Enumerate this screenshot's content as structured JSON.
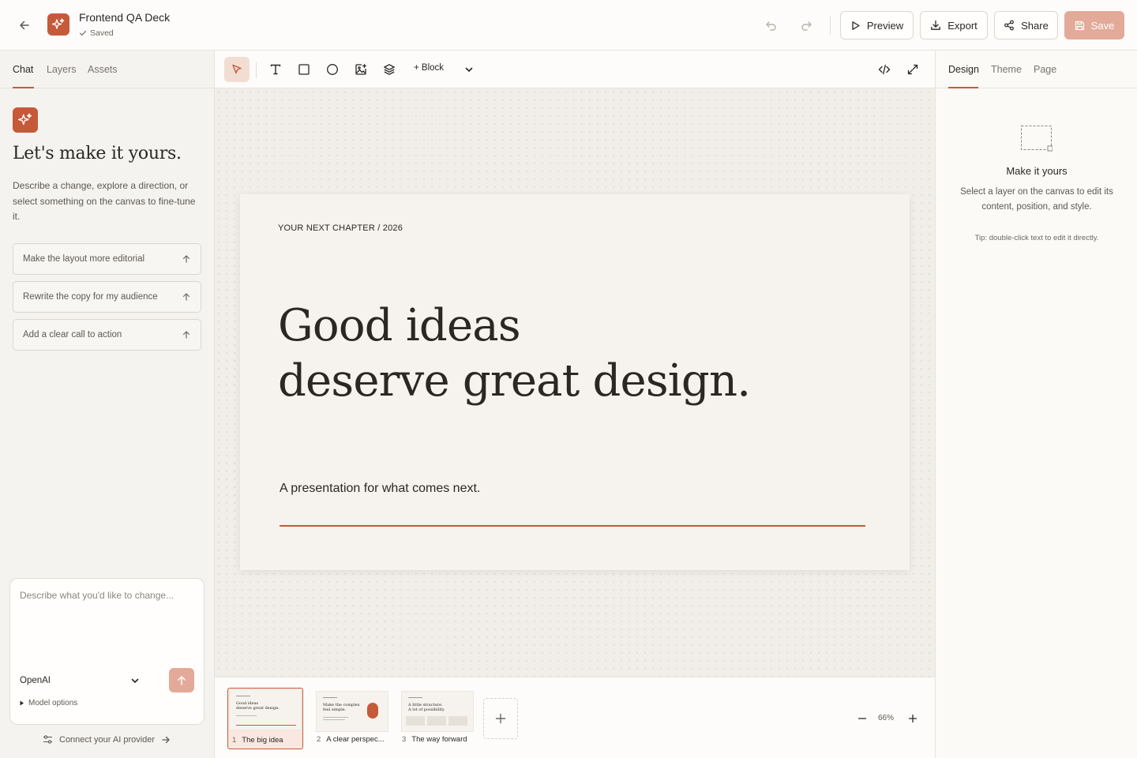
{
  "topbar": {
    "doc_title": "Frontend QA Deck",
    "status": "Saved",
    "preview_label": "Preview",
    "export_label": "Export",
    "share_label": "Share",
    "save_label": "Save"
  },
  "left_panel": {
    "tabs": [
      "Chat",
      "Layers",
      "Assets"
    ],
    "heading": "Let's make it yours.",
    "description": "Describe a change, explore a direction, or select something on the canvas to fine-tune it.",
    "suggestions": [
      "Make the layout more editorial",
      "Rewrite the copy for my audience",
      "Add a clear call to action"
    ],
    "composer": {
      "placeholder": "Describe what you'd like to change...",
      "value": "",
      "model": "OpenAI",
      "model_options_label": "Model options"
    },
    "connect_label": "Connect your AI provider"
  },
  "toolbar": {
    "block_label": "+ Block"
  },
  "slide": {
    "eyebrow": "YOUR NEXT CHAPTER / 2026",
    "title_line1": "Good ideas",
    "title_line2": "deserve great design.",
    "subtitle": "A presentation for what comes next."
  },
  "filmstrip": {
    "slides": [
      {
        "num": "1",
        "label": "The big idea",
        "mini_title_line1": "Good ideas",
        "mini_title_line2": "deserve great design."
      },
      {
        "num": "2",
        "label": "A clear perspec...",
        "mini_title_line1": "Make the complex",
        "mini_title_line2": "feel simple."
      },
      {
        "num": "3",
        "label": "The way forward",
        "mini_title_line1": "A little structure.",
        "mini_title_line2": "A lot of possibility."
      }
    ],
    "zoom": "66%"
  },
  "right_panel": {
    "tabs": [
      "Design",
      "Theme",
      "Page"
    ],
    "empty_title": "Make it yours",
    "empty_desc": "Select a layer on the canvas to edit its content, position, and style.",
    "tip": "Tip: double-click text to edit it directly."
  },
  "colors": {
    "accent": "#c55a3b",
    "accent_light": "#e3aa99",
    "canvas_bg": "#f1eee9",
    "slide_bg": "#f6f3ee"
  }
}
